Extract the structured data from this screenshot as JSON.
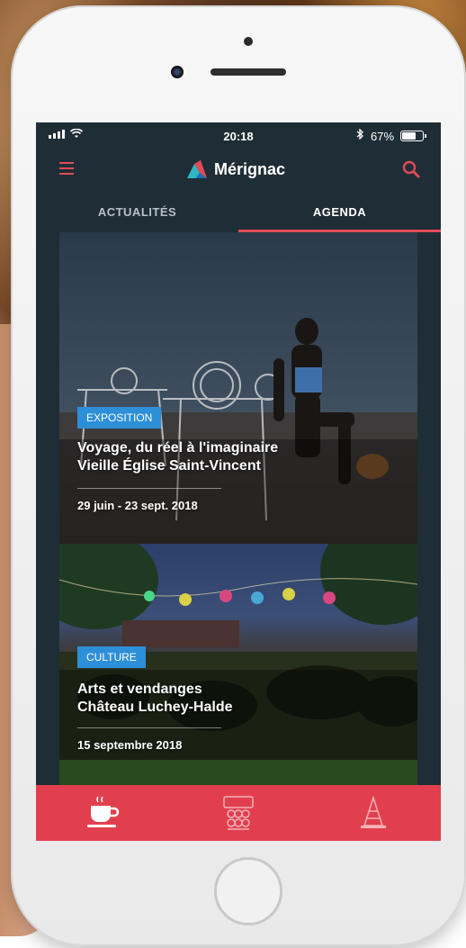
{
  "status_bar": {
    "time": "20:18",
    "battery": "67%",
    "battery_level": 0.67
  },
  "header": {
    "app_name": "Mérignac",
    "menu_icon": "hamburger-menu-icon",
    "search_icon": "search-icon"
  },
  "tabs": [
    {
      "label": "ACTUALITÉS",
      "active": false
    },
    {
      "label": "AGENDA",
      "active": true
    }
  ],
  "events": [
    {
      "tag": "EXPOSITION",
      "title": "Voyage, du réel à l'imaginaire",
      "venue": "Vieille Église Saint-Vincent",
      "date": "29 juin - 23 sept. 2018"
    },
    {
      "tag": "CULTURE",
      "title": "Arts et vendanges",
      "venue": "Château Luchey-Halde",
      "date": "15 septembre 2018"
    }
  ],
  "bottom_nav": [
    {
      "icon": "coffee-cup-icon",
      "active": true
    },
    {
      "icon": "theater-seats-icon",
      "active": false
    },
    {
      "icon": "traffic-cone-icon",
      "active": false
    }
  ],
  "colors": {
    "accent": "#e14a57",
    "tag_blue": "#2d8fd8",
    "screen_bg": "#1f2d36"
  }
}
